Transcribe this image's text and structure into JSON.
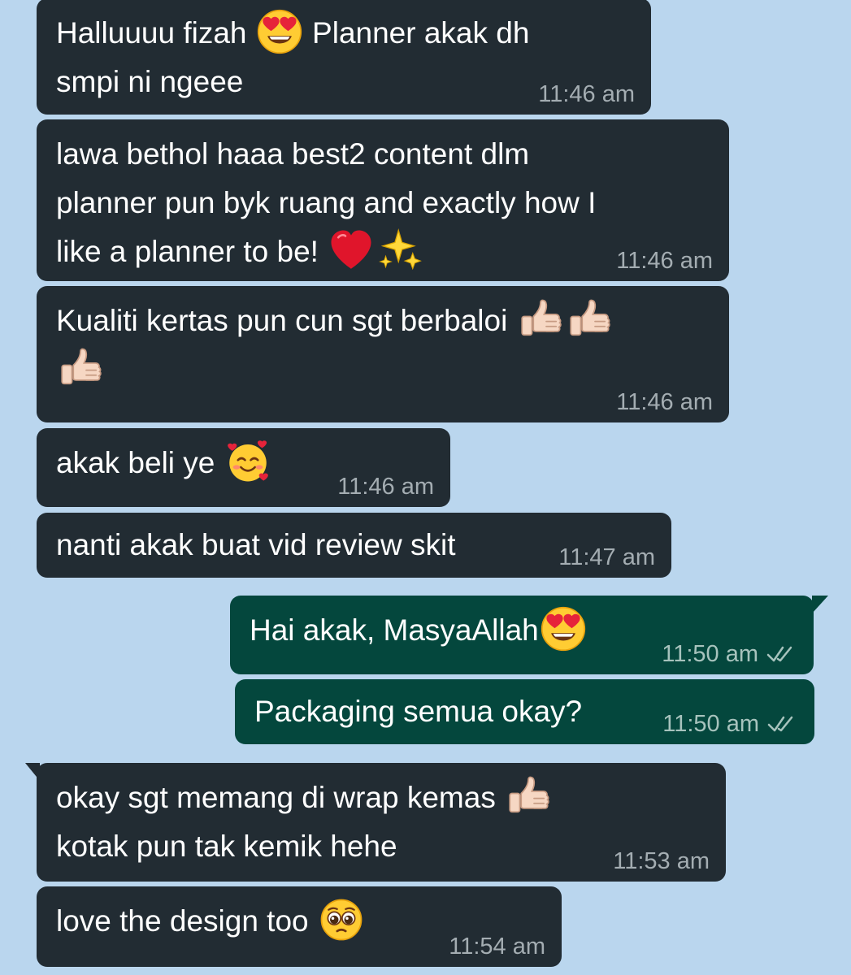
{
  "messages": [
    {
      "line1": "Halluuuu fizah",
      "line1b": "Planner akak dh",
      "line2": "smpi ni ngeee",
      "time": "11:46 am"
    },
    {
      "line1": "lawa bethol haaa best2 content dlm",
      "line2": "planner pun byk ruang and exactly how I",
      "line3": "like a planner to be!",
      "time": "11:46 am"
    },
    {
      "line1": "Kualiti kertas pun cun sgt berbaloi",
      "time": "11:46 am"
    },
    {
      "line1": "akak beli ye",
      "time": "11:46 am"
    },
    {
      "line1": "nanti akak buat vid review skit",
      "time": "11:47 am"
    },
    {
      "line1": "Hai akak, MasyaAllah",
      "time": "11:50 am"
    },
    {
      "line1": "Packaging semua okay?",
      "time": "11:50 am"
    },
    {
      "line1": "okay sgt memang di wrap kemas",
      "line2": "kotak pun tak kemik hehe",
      "time": "11:53 am"
    },
    {
      "line1": "love the design too",
      "time": "11:54 am"
    }
  ],
  "icons": {
    "heart_eyes": "heart-eyes-emoji",
    "red_heart": "red-heart-emoji",
    "sparkles": "sparkles-emoji",
    "thumbs_up": "thumbs-up-emoji",
    "smiling_hearts": "smiling-face-with-hearts-emoji",
    "pleading": "pleading-face-emoji",
    "read_receipt": "double-check-icon"
  },
  "colors": {
    "background": "#bad6ee",
    "incoming_bubble": "#222c33",
    "outgoing_bubble": "#04473d",
    "read_receipt": "#a7c3bd"
  }
}
